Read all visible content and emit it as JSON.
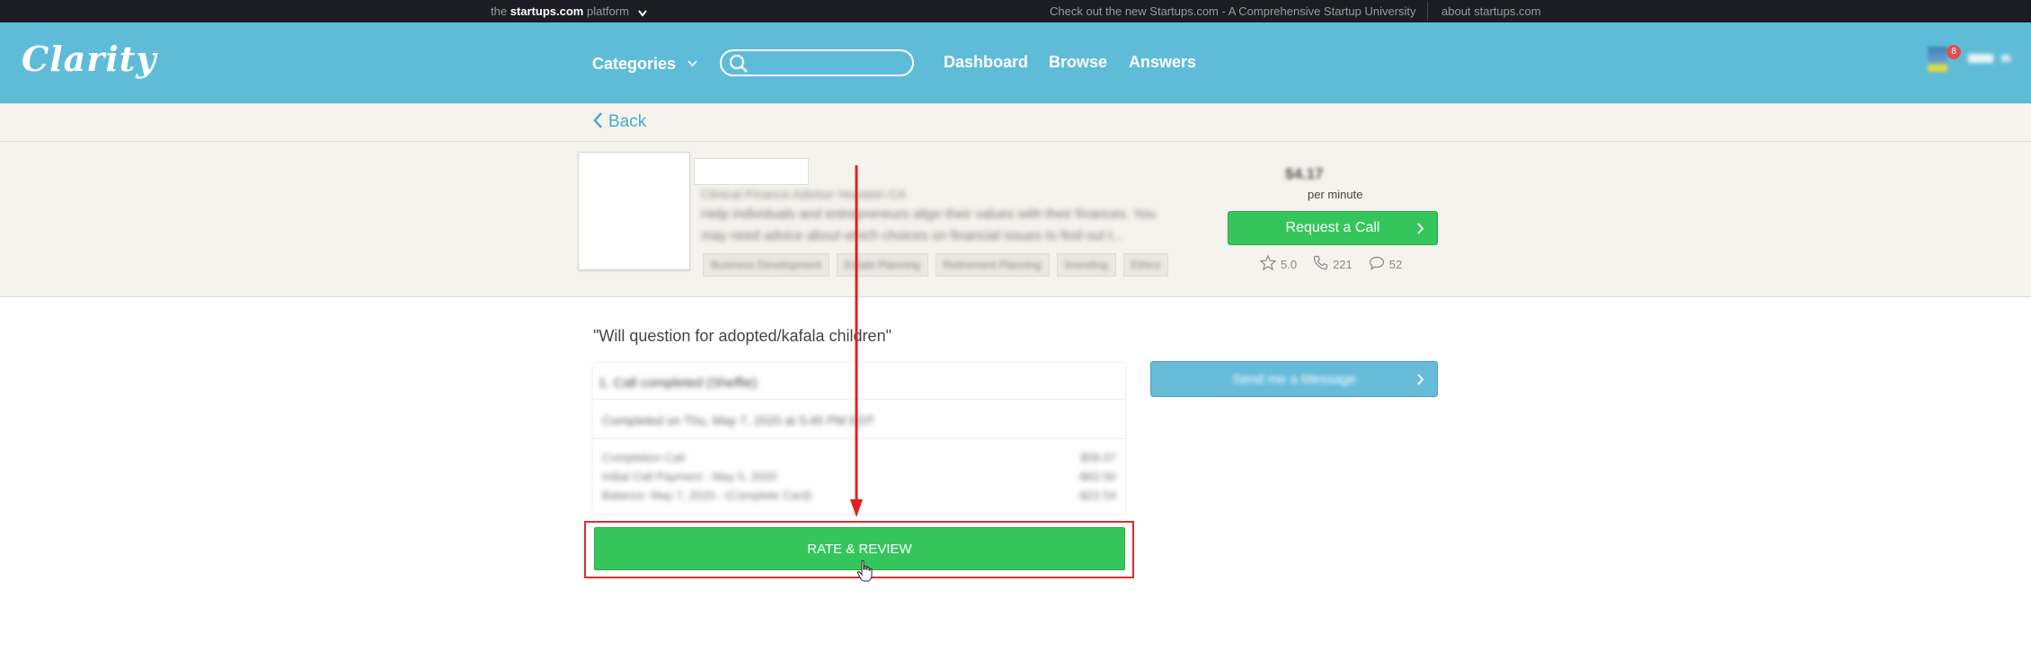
{
  "platform_bar": {
    "the": "the",
    "brand": "startups.com",
    "platform": "platform",
    "promo": "Check out the new Startups.com - A Comprehensive Startup University",
    "about": "about startups.com"
  },
  "header": {
    "logo": "Clarity",
    "categories": "Categories",
    "search_value": "",
    "nav": [
      "Dashboard",
      "Browse",
      "Answers"
    ],
    "notifications": "8"
  },
  "back_label": "Back",
  "expert": {
    "name": "",
    "title": "Clinical Finance Advisor Houston CA",
    "bio_line1": "Help individuals and entrepreneurs align their values with their finances. You",
    "bio_line2": "may need advice about which choices on financial issues to find out t...",
    "tags": [
      "Business Development",
      "Estate Planning",
      "Retirement Planning",
      "Investing",
      "Ethics"
    ],
    "rate": "$4.17",
    "per_minute": "per minute",
    "request_call": "Request a Call",
    "rating": "5.0",
    "calls": "221",
    "reviews": "52"
  },
  "call": {
    "question": "\"Will question for adopted/kafala children\"",
    "send_message": "Send me a Message",
    "summary_title": "1. Call completed (Sheffie)",
    "completed_on": "Completed on Thu, May 7, 2020 at 5:45 PM EDT",
    "line_items": [
      {
        "label": "Completion Call",
        "amount": "$58.07"
      },
      {
        "label": "Initial Call Payment - May 5, 2020",
        "amount": "-$62.50"
      },
      {
        "label": "Balance: May 7, 2020 - (Complete Card)",
        "amount": "-$22.54"
      }
    ],
    "rate_review": "RATE & REVIEW"
  },
  "colors": {
    "header_bg": "#5fbcd9",
    "green_button": "#35c65b",
    "blue_button": "#67bcd9",
    "annotation_red": "#d63030"
  }
}
